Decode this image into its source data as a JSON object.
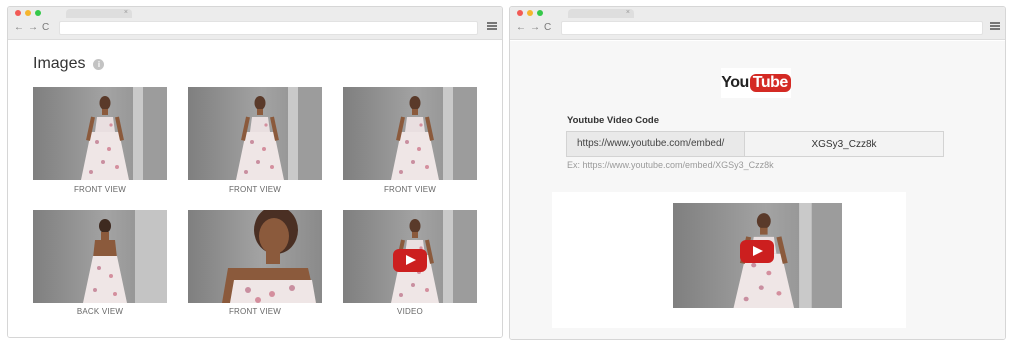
{
  "colors": {
    "dot_red": "#f25a55",
    "dot_yellow": "#f5b52e",
    "dot_green": "#35c84a",
    "youtube_red": "#cc1f1f",
    "wall_gray": "#8a8a8a"
  },
  "browser": {
    "nav_icons": [
      "back-arrow-icon",
      "forward-arrow-icon",
      "reload-icon"
    ],
    "nav_glyphs": {
      "back": "←",
      "forward": "→",
      "reload": "C"
    },
    "tab_close": "×",
    "menu_icon": "hamburger-menu-icon"
  },
  "images_panel": {
    "title": "Images",
    "info_glyph": "i",
    "items": [
      {
        "caption": "FRONT VIEW",
        "kind": "image"
      },
      {
        "caption": "FRONT VIEW",
        "kind": "image"
      },
      {
        "caption": "FRONT VIEW",
        "kind": "image"
      },
      {
        "caption": "BACK VIEW",
        "kind": "image"
      },
      {
        "caption": "FRONT VIEW",
        "kind": "image"
      },
      {
        "caption": "VIDEO",
        "kind": "video"
      }
    ]
  },
  "youtube_panel": {
    "logo_you": "You",
    "logo_tube": "Tube",
    "label": "Youtube Video Code",
    "url_prefix": "https://www.youtube.com/embed/",
    "code_value": "XGSy3_Czz8k",
    "example": "Ex: https://www.youtube.com/embed/XGSy3_Czz8k"
  }
}
